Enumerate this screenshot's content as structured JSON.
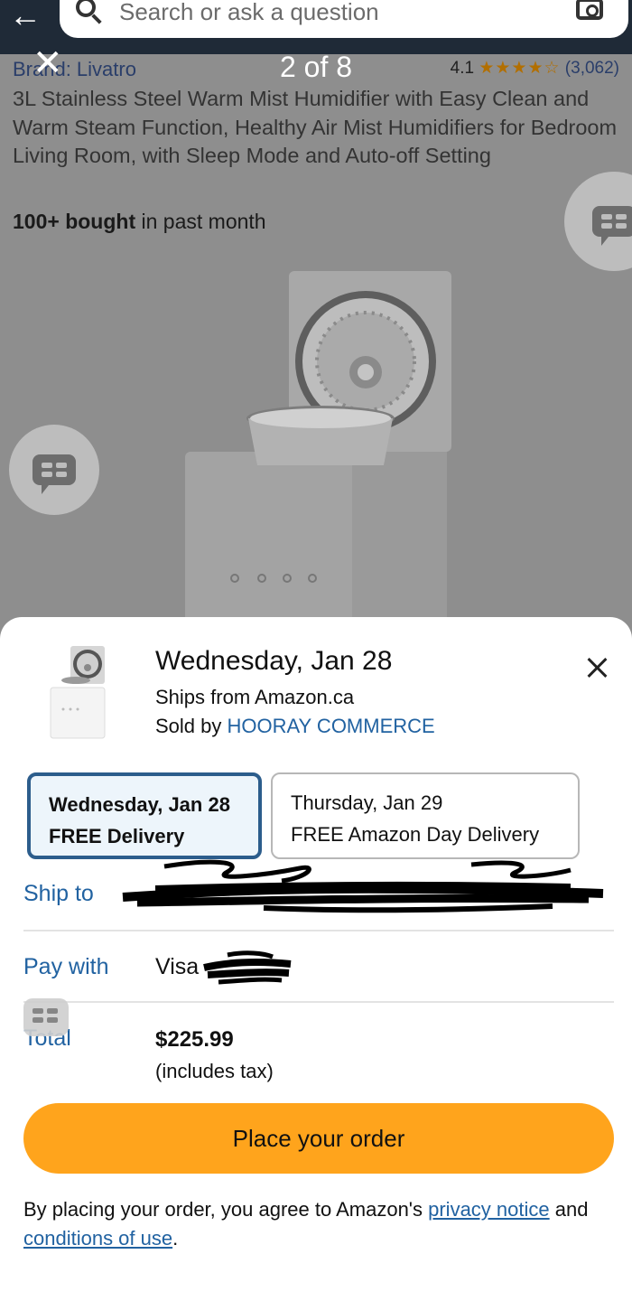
{
  "colors": {
    "accent": "#ffa41c",
    "link": "#2162a1",
    "selected_border": "#2c5d8c",
    "header": "#1f2a37"
  },
  "header": {
    "search_placeholder": "Search or ask a question",
    "back_icon": "back-arrow-icon",
    "camera_icon": "camera-icon"
  },
  "viewer": {
    "counter": "2 of 8",
    "close_icon": "close-icon"
  },
  "product": {
    "brand": "Brand: Livatro",
    "rating_value": "4.1",
    "rating_stars": "★★★★☆",
    "rating_count": "(3,062)",
    "title": "3L Stainless Steel Warm Mist Humidifier with Easy Clean and Warm Steam Function, Healthy Air Mist Humidifiers for Bedroom Living Room, with Sleep Mode and Auto-off Setting",
    "bought_bold": "100+ bought",
    "bought_rest": " in past month"
  },
  "sheet": {
    "delivery_date": "Wednesday, Jan 28",
    "ships_from": "Ships from Amazon.ca",
    "sold_by_prefix": "Sold by ",
    "seller": "HOORAY COMMERCE",
    "options": [
      {
        "line1": "Wednesday, Jan 28",
        "line2": "FREE Delivery",
        "selected": true
      },
      {
        "line1": "Thursday, Jan 29",
        "line2": "FREE Amazon Day Delivery",
        "selected": false
      }
    ],
    "ship_to_label": "Ship to",
    "pay_with_label": "Pay with",
    "pay_with_value": "Visa",
    "total_label": "Total",
    "total_amount": "$225.99",
    "total_note": "(includes tax)",
    "order_button": "Place your order",
    "legal_prefix": "By placing your order, you agree to Amazon's ",
    "privacy_link": "privacy notice",
    "legal_middle": " and ",
    "conditions_link": "conditions of use",
    "legal_suffix": "."
  }
}
